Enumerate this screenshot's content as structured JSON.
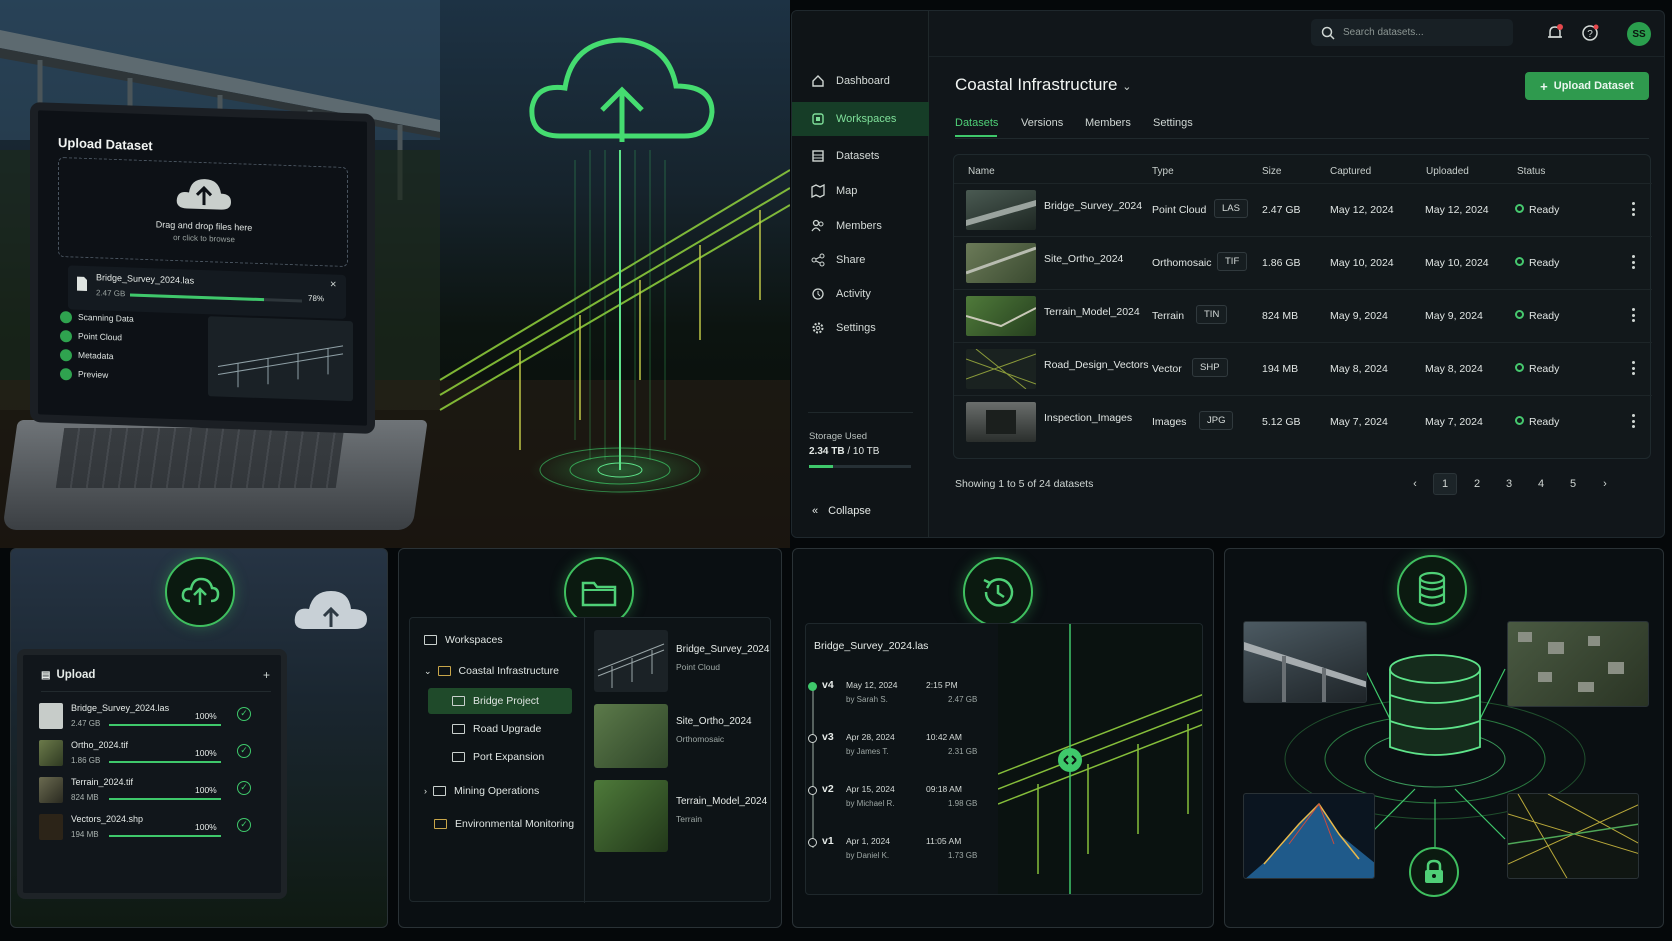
{
  "hero": {
    "upload_title": "Upload Dataset",
    "drop_text": "Drag and drop files here",
    "drop_sub": "or click to browse",
    "file_name": "Bridge_Survey_2024.las",
    "file_size": "2.47 GB",
    "progress_label": "78%",
    "progress": 0.78,
    "steps": [
      "Scanning Data",
      "Point Cloud",
      "Metadata",
      "Preview"
    ]
  },
  "app": {
    "search_placeholder": "Search datasets...",
    "avatar_initials": "SS",
    "sidebar": {
      "items": [
        {
          "label": "Dashboard",
          "icon": "home-icon"
        },
        {
          "label": "Workspaces",
          "icon": "workspace-icon",
          "active": true
        },
        {
          "label": "Datasets",
          "icon": "datasets-icon"
        },
        {
          "label": "Map",
          "icon": "map-icon"
        },
        {
          "label": "Members",
          "icon": "members-icon"
        },
        {
          "label": "Share",
          "icon": "share-icon"
        },
        {
          "label": "Activity",
          "icon": "activity-icon"
        },
        {
          "label": "Settings",
          "icon": "settings-icon"
        }
      ],
      "storage_label": "Storage Used",
      "storage_used": "2.34 TB",
      "storage_total": "10 TB",
      "storage_fraction": 0.234,
      "collapse_label": "Collapse"
    },
    "workspace_title": "Coastal Infrastructure",
    "upload_button": "Upload Dataset",
    "tabs": [
      "Datasets",
      "Versions",
      "Members",
      "Settings"
    ],
    "active_tab": "Datasets",
    "columns": [
      "Name",
      "Type",
      "Size",
      "Captured",
      "Uploaded",
      "Status"
    ],
    "rows": [
      {
        "name": "Bridge_Survey_2024",
        "type": "Point Cloud",
        "format": "LAS",
        "size": "2.47 GB",
        "captured": "May 12, 2024",
        "uploaded": "May 12, 2024",
        "status": "Ready"
      },
      {
        "name": "Site_Ortho_2024",
        "type": "Orthomosaic",
        "format": "TIF",
        "size": "1.86 GB",
        "captured": "May 10, 2024",
        "uploaded": "May 10, 2024",
        "status": "Ready"
      },
      {
        "name": "Terrain_Model_2024",
        "type": "Terrain",
        "format": "TIN",
        "size": "824 MB",
        "captured": "May 9, 2024",
        "uploaded": "May 9, 2024",
        "status": "Ready"
      },
      {
        "name": "Road_Design_Vectors",
        "type": "Vector",
        "format": "SHP",
        "size": "194 MB",
        "captured": "May 8, 2024",
        "uploaded": "May 8, 2024",
        "status": "Ready"
      },
      {
        "name": "Inspection_Images",
        "type": "Images",
        "format": "JPG",
        "size": "5.12 GB",
        "captured": "May 7, 2024",
        "uploaded": "May 7, 2024",
        "status": "Ready"
      }
    ],
    "showing_text": "Showing 1 to 5 of 24 datasets",
    "pages": [
      "1",
      "2",
      "3",
      "4",
      "5"
    ],
    "current_page": "1"
  },
  "panel_upload": {
    "title": "Upload",
    "plus": "+",
    "files": [
      {
        "name": "Bridge_Survey_2024.las",
        "size": "2.47 GB",
        "pct": "100%"
      },
      {
        "name": "Ortho_2024.tif",
        "size": "1.86 GB",
        "pct": "100%"
      },
      {
        "name": "Terrain_2024.tif",
        "size": "824 MB",
        "pct": "100%"
      },
      {
        "name": "Vectors_2024.shp",
        "size": "194 MB",
        "pct": "100%"
      }
    ]
  },
  "panel_tree": {
    "root": "Workspaces",
    "workspace": "Coastal Infrastructure",
    "projects": [
      "Bridge Project",
      "Road Upgrade",
      "Port Expansion"
    ],
    "active_project": "Bridge Project",
    "others": [
      "Mining Operations",
      "Environmental Monitoring"
    ],
    "cards": [
      {
        "name": "Bridge_Survey_2024",
        "type": "Point Cloud"
      },
      {
        "name": "Site_Ortho_2024",
        "type": "Orthomosaic"
      },
      {
        "name": "Terrain_Model_2024",
        "type": "Terrain"
      }
    ]
  },
  "panel_versions": {
    "file": "Bridge_Survey_2024.las",
    "versions": [
      {
        "v": "v4",
        "date": "May 12, 2024",
        "time": "2:15 PM",
        "by": "by Sarah S.",
        "size": "2.47 GB"
      },
      {
        "v": "v3",
        "date": "Apr 28, 2024",
        "time": "10:42 AM",
        "by": "by James T.",
        "size": "2.31 GB"
      },
      {
        "v": "v2",
        "date": "Apr 15, 2024",
        "time": "09:18 AM",
        "by": "by Michael R.",
        "size": "1.98 GB"
      },
      {
        "v": "v1",
        "date": "Apr 1, 2024",
        "time": "11:05 AM",
        "by": "by Daniel K.",
        "size": "1.73 GB"
      }
    ]
  },
  "colors": {
    "accent": "#3fc86b",
    "bg": "#05080a",
    "panel": "#11161a"
  }
}
